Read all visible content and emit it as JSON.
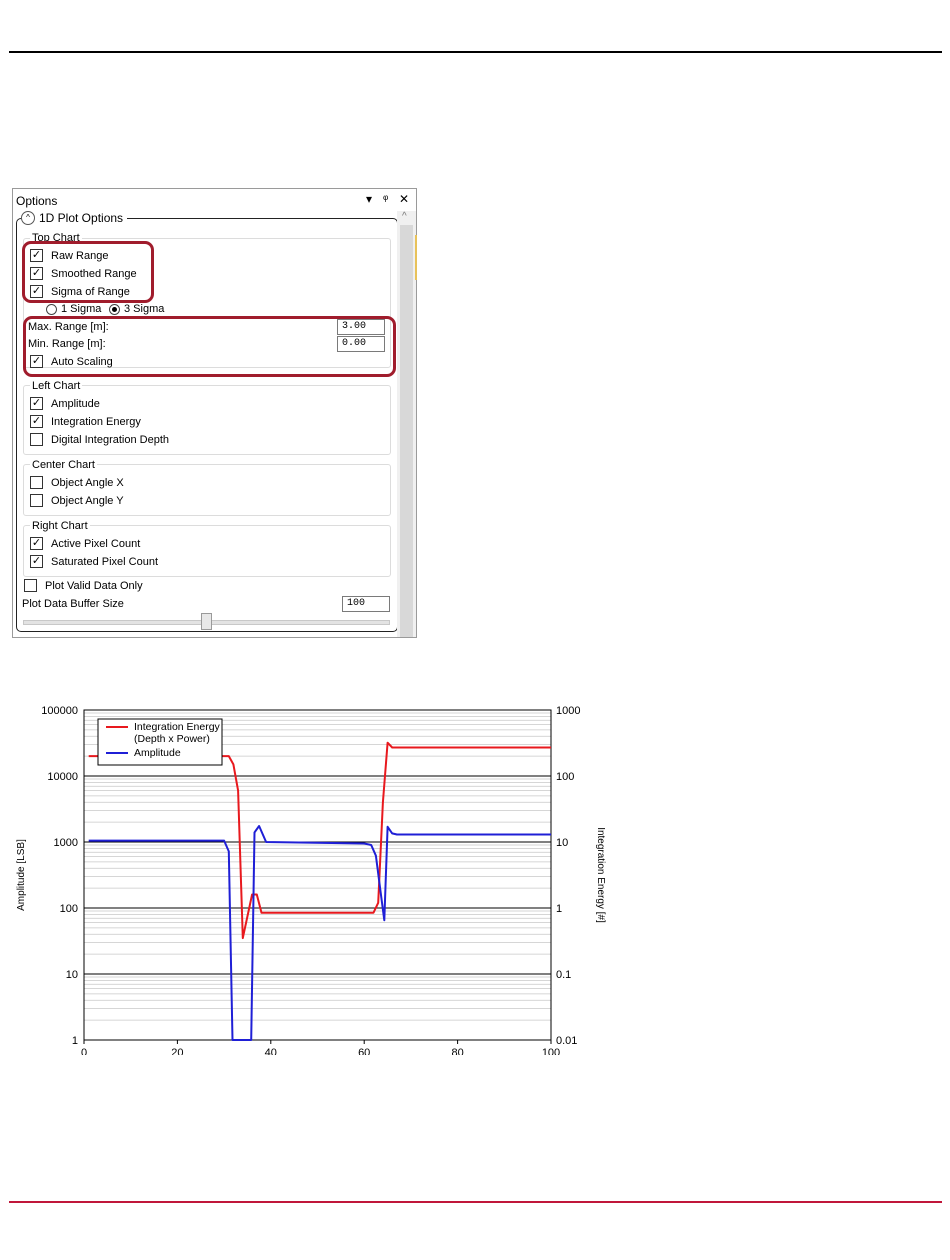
{
  "panel": {
    "title": "Options",
    "section": "1D Plot Options",
    "top_chart": {
      "label": "Top Chart",
      "raw_range": "Raw Range",
      "smoothed_range": "Smoothed Range",
      "sigma_of_range": "Sigma of Range",
      "one_sigma": "1 Sigma",
      "three_sigma": "3 Sigma",
      "max_range_label": "Max. Range [m]:",
      "max_range_value": "3.00",
      "min_range_label": "Min. Range [m]:",
      "min_range_value": "0.00",
      "auto_scaling": "Auto Scaling"
    },
    "left_chart": {
      "label": "Left Chart",
      "amplitude": "Amplitude",
      "integration_energy": "Integration Energy",
      "digital_integration_depth": "Digital Integration Depth"
    },
    "center_chart": {
      "label": "Center Chart",
      "object_angle_x": "Object Angle X",
      "object_angle_y": "Object Angle Y"
    },
    "right_chart": {
      "label": "Right Chart",
      "active_pixel_count": "Active Pixel Count",
      "saturated_pixel_count": "Saturated Pixel Count"
    },
    "plot_valid_data_only": "Plot Valid Data Only",
    "buffer_size_label": "Plot Data Buffer Size",
    "buffer_size_value": "100",
    "buffer_slider_fraction": 0.5,
    "checked": {
      "raw_range": true,
      "smoothed_range": true,
      "sigma_of_range": true,
      "auto_scaling": true,
      "amplitude": true,
      "integration_energy": true,
      "digital_integration_depth": false,
      "object_angle_x": false,
      "object_angle_y": false,
      "active_pixel_count": true,
      "saturated_pixel_count": true,
      "plot_valid_data_only": false
    },
    "selected_sigma": "3 Sigma",
    "highlight_color": "#a01c2c"
  },
  "chart_data": {
    "type": "line",
    "title": "",
    "xlabel": "",
    "ylabel": "Amplitude [LSB]",
    "y2label": "Integration Energy [#]",
    "xlim": [
      0,
      100
    ],
    "ylim": [
      1,
      100000
    ],
    "y2lim": [
      0.01,
      1000
    ],
    "log_y": true,
    "grid": true,
    "legend_position": "top-left",
    "x_ticks": [
      "0",
      "20",
      "40",
      "60",
      "80",
      "100"
    ],
    "y_ticks": [
      "1",
      "10",
      "100",
      "1000",
      "10000",
      "100000"
    ],
    "y2_ticks": [
      "0.01",
      "0.1",
      "1",
      "10",
      "100",
      "1000"
    ],
    "series": [
      {
        "name": "Integration Energy\n(Depth x Power)",
        "axis": "right",
        "color": "#e8191e",
        "points": [
          [
            1,
            200
          ],
          [
            31,
            200
          ],
          [
            32,
            150
          ],
          [
            33,
            60
          ],
          [
            34,
            0.35
          ],
          [
            36,
            1.6
          ],
          [
            37,
            1.6
          ],
          [
            38,
            0.85
          ],
          [
            62,
            0.85
          ],
          [
            63,
            1.2
          ],
          [
            64,
            40
          ],
          [
            65,
            320
          ],
          [
            66,
            270
          ],
          [
            100,
            270
          ]
        ]
      },
      {
        "name": "Amplitude",
        "axis": "left",
        "color": "#1f1fd6",
        "points": [
          [
            1,
            1050
          ],
          [
            30,
            1050
          ],
          [
            31,
            720
          ],
          [
            31.8,
            1
          ],
          [
            35.8,
            1
          ],
          [
            36.5,
            1400
          ],
          [
            37.5,
            1750
          ],
          [
            39,
            1000
          ],
          [
            60,
            950
          ],
          [
            61.5,
            900
          ],
          [
            62.5,
            620
          ],
          [
            63.5,
            180
          ],
          [
            64.3,
            65
          ],
          [
            65,
            1700
          ],
          [
            66,
            1350
          ],
          [
            67,
            1300
          ],
          [
            100,
            1300
          ]
        ]
      }
    ]
  }
}
